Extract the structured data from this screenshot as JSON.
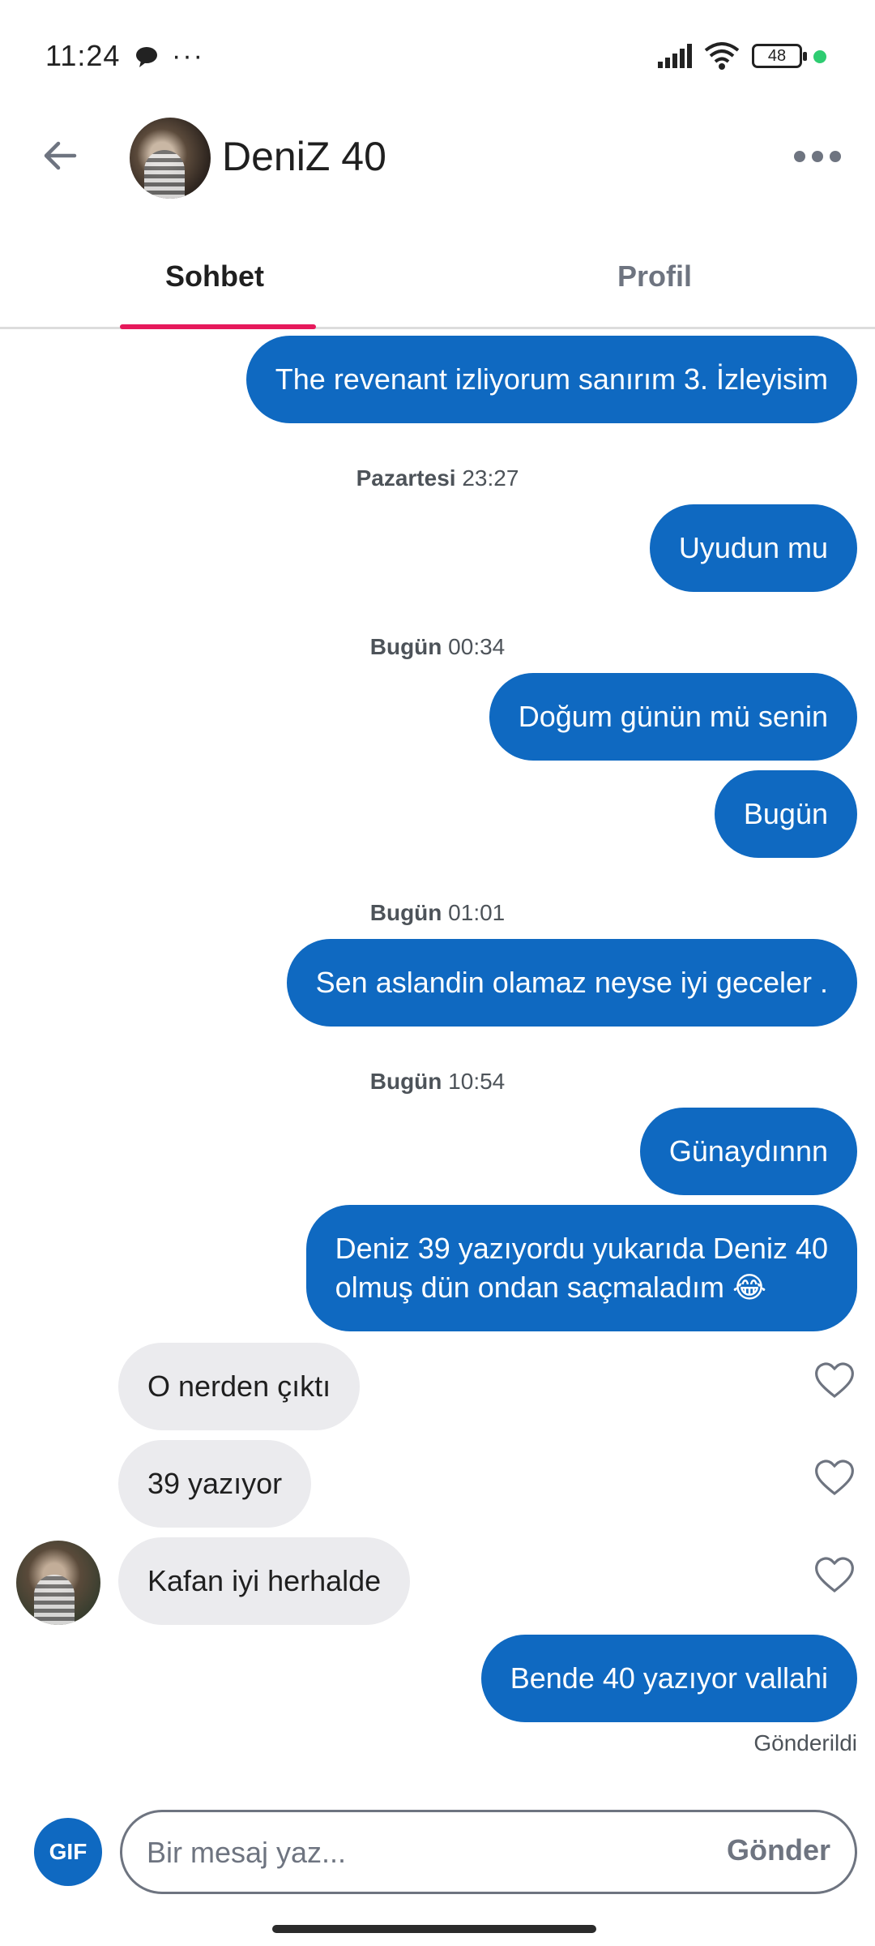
{
  "status_bar": {
    "time": "11:24",
    "more": "···",
    "battery": "48",
    "dot_color": "#2ecc71"
  },
  "header": {
    "contact_name": "DeniZ 40",
    "back_icon": "arrow-left-icon",
    "more_icon": "more-horizontal-icon"
  },
  "tabs": [
    {
      "label": "Sohbet",
      "active": true
    },
    {
      "label": "Profil",
      "active": false
    }
  ],
  "messages": [
    {
      "type": "out",
      "text": "The revenant izliyorum sanırım 3. İzleyisim"
    },
    {
      "type": "timestamp",
      "day": "Pazartesi",
      "time": "23:27"
    },
    {
      "type": "out",
      "text": "Uyudun mu"
    },
    {
      "type": "timestamp",
      "day": "Bugün",
      "time": "00:34"
    },
    {
      "type": "out",
      "text": "Doğum günün mü senin"
    },
    {
      "type": "out",
      "text": "Bugün"
    },
    {
      "type": "timestamp",
      "day": "Bugün",
      "time": "01:01"
    },
    {
      "type": "out",
      "text": "Sen aslandin olamaz neyse iyi geceler ."
    },
    {
      "type": "timestamp",
      "day": "Bugün",
      "time": "10:54"
    },
    {
      "type": "out",
      "text": "Günaydınnn"
    },
    {
      "type": "out",
      "line1": "Deniz 39 yazıyordu yukarıda Deniz 40",
      "line2": "olmuş dün ondan saçmaladım 😂"
    },
    {
      "type": "in",
      "text": "O nerden çıktı"
    },
    {
      "type": "in",
      "text": "39 yazıyor"
    },
    {
      "type": "in",
      "text": "Kafan iyi herhalde"
    },
    {
      "type": "out",
      "text": "Bende 40 yazıyor vallahi"
    }
  ],
  "delivery_status": "Gönderildi",
  "composer": {
    "gif_label": "GIF",
    "placeholder": "Bir mesaj yaz...",
    "send_label": "Gönder"
  },
  "colors": {
    "outgoing_bubble": "#0f69c1",
    "incoming_bubble": "#ebebee",
    "tab_accent": "#e6195b"
  }
}
